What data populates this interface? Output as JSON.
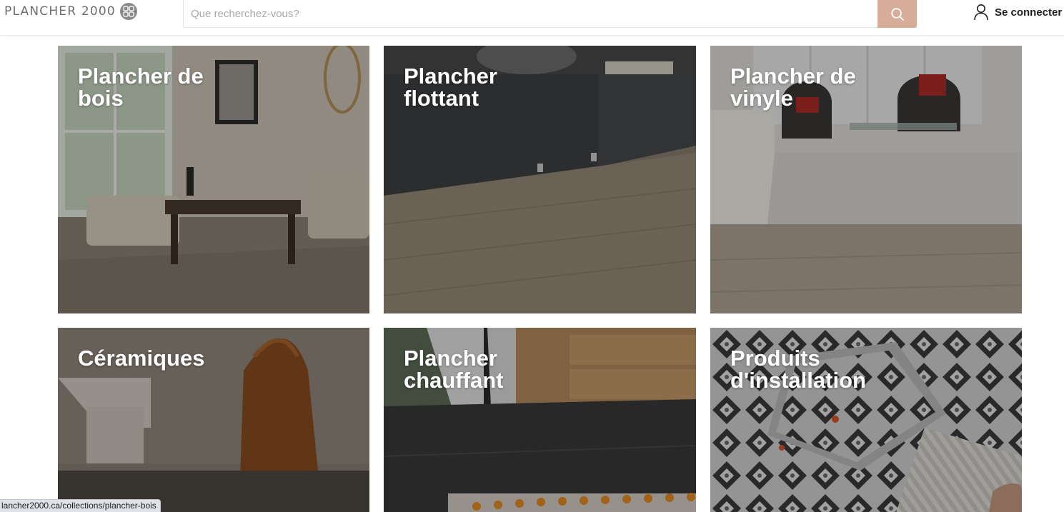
{
  "header": {
    "logo_text": "PLANCHER 2000",
    "search_placeholder": "Que recherchez-vous?",
    "search_button_icon": "search-icon",
    "login_label": "Se connecter",
    "login_icon": "user-icon"
  },
  "colors": {
    "search_button": "#d7ac98",
    "tile_text": "#ffffff",
    "logo_gray": "#6e6e6e"
  },
  "categories": [
    {
      "title": "Plancher de\nbois"
    },
    {
      "title": "Plancher\nflottant"
    },
    {
      "title": "Plancher de\nvinyle"
    },
    {
      "title": "Céramiques"
    },
    {
      "title": "Plancher\nchauffant"
    },
    {
      "title": "Produits\nd'installation"
    }
  ],
  "status_bar": {
    "url": "lancher2000.ca/collections/plancher-bois"
  }
}
